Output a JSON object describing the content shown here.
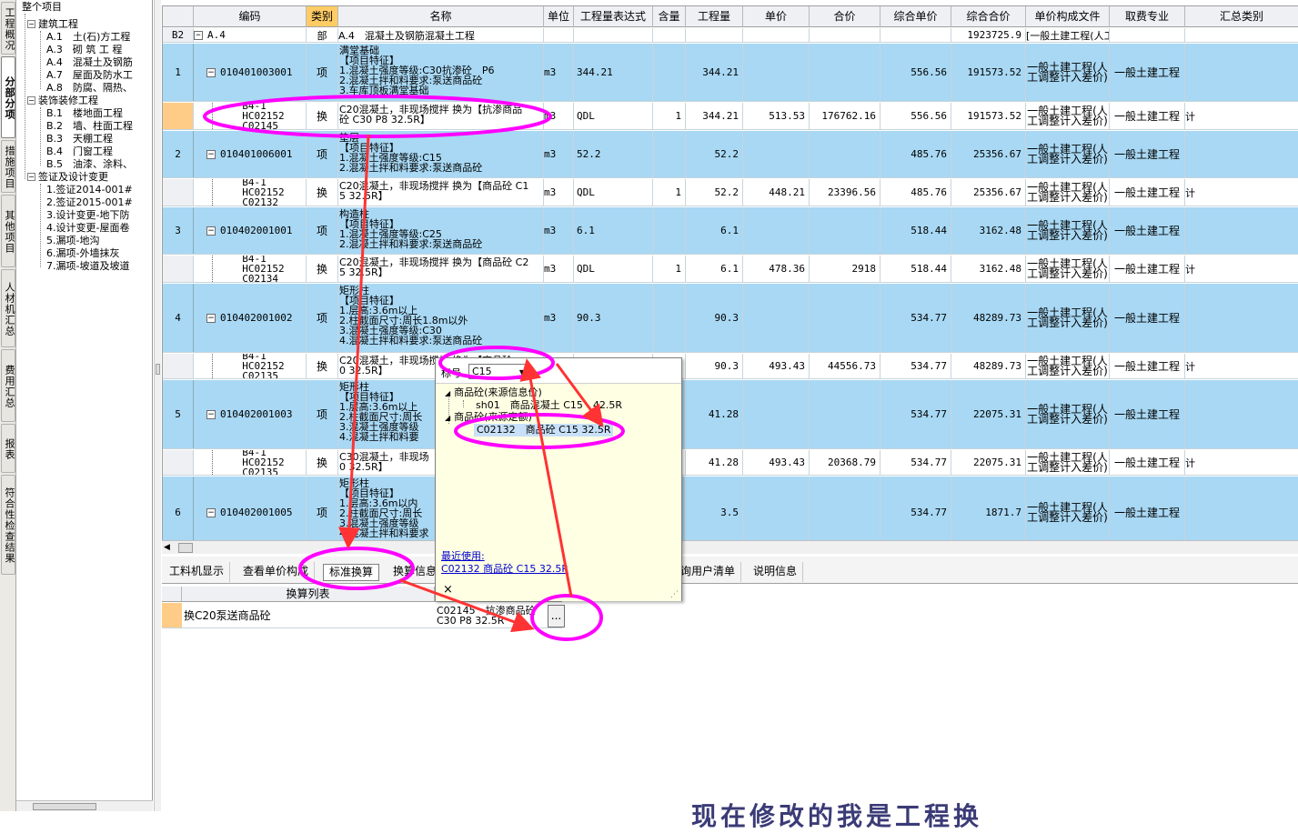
{
  "vtabs": [
    "工程概况",
    "分部分项",
    "措施项目",
    "其他项目",
    "人材机汇总",
    "费用汇总",
    "报表",
    "符合性检查结果"
  ],
  "tree": {
    "root": "整个项目",
    "groups": [
      {
        "label": "建筑工程",
        "items": [
          "A.1　土(石)方工程",
          "A.3　砌 筑 工 程",
          "A.4　混凝土及钢筋",
          "A.7　屋面及防水工",
          "A.8　防腐、隔热、"
        ]
      },
      {
        "label": "装饰装修工程",
        "items": [
          "B.1　楼地面工程",
          "B.2　墙、柱面工程",
          "B.3　天棚工程",
          "B.4　门窗工程",
          "B.5　油漆、涂料、"
        ]
      },
      {
        "label": "签证及设计变更",
        "items": [
          "1.签证2014-001#",
          "2.签证2015-001#",
          "3.设计变更-地下防",
          "4.设计变更-屋面卷",
          "5.漏项-地沟",
          "6.漏项-外墙抹灰",
          "7.漏项-坡道及坡道"
        ]
      }
    ]
  },
  "grid": {
    "headers": [
      "编码",
      "类别",
      "名称",
      "单位",
      "工程量表达式",
      "含量",
      "工程量",
      "单价",
      "合价",
      "综合单价",
      "综合合价",
      "单价构成文件",
      "取费专业",
      "汇总类别"
    ],
    "b2_row": {
      "rowhead": "B2",
      "code": "A.4",
      "type": "部",
      "name": "A.4　混凝土及钢筋混凝土工程",
      "total": "1923725.9",
      "file": "[一般土建工程(人工"
    },
    "rows": [
      {
        "kind": "item",
        "rowhead": "1",
        "code": "010401003001",
        "type": "项",
        "name": "满堂基础\n【项目特征】\n1.混凝土强度等级:C30抗渗砼　P6\n2.混凝土拌和料要求:泵送商品砼\n3.车库顶板满堂基础",
        "unit": "m3",
        "expr": "344.21",
        "content": "",
        "qty": "344.21",
        "price": "",
        "amount": "",
        "uprice": "556.56",
        "total": "191573.52",
        "file": "一般土建工程(人工调整计入差价)",
        "spec": "一般土建工程",
        "cat": ""
      },
      {
        "kind": "sub",
        "rowhead": "",
        "code": "B4-1 HC02152 C02145",
        "type": "换",
        "name": "C20混凝土，非现场搅拌 换为【抗渗商品\n砼 C30 P8 32.5R】",
        "unit": "m3",
        "expr": "QDL",
        "content": "1",
        "qty": "344.21",
        "price": "513.53",
        "amount": "176762.16",
        "uprice": "556.56",
        "total": "191573.52",
        "file": "一般土建工程(人工调整计入差价)",
        "spec": "一般土建工程",
        "cat": "计"
      },
      {
        "kind": "item",
        "rowhead": "2",
        "code": "010401006001",
        "type": "项",
        "name": "垫层\n【项目特征】\n1.混凝土强度等级:C15\n2.混凝土拌和料要求:泵送商品砼",
        "unit": "m3",
        "expr": "52.2",
        "content": "",
        "qty": "52.2",
        "price": "",
        "amount": "",
        "uprice": "485.76",
        "total": "25356.67",
        "file": "一般土建工程(人工调整计入差价)",
        "spec": "一般土建工程",
        "cat": ""
      },
      {
        "kind": "sub",
        "rowhead": "",
        "code": "B4-1 HC02152 C02132",
        "type": "换",
        "name": "C20混凝土，非现场搅拌 换为【商品砼 C1\n5 32.5R】",
        "unit": "m3",
        "expr": "QDL",
        "content": "1",
        "qty": "52.2",
        "price": "448.21",
        "amount": "23396.56",
        "uprice": "485.76",
        "total": "25356.67",
        "file": "一般土建工程(人工调整计入差价)",
        "spec": "一般土建工程",
        "cat": "计"
      },
      {
        "kind": "item",
        "rowhead": "3",
        "code": "010402001001",
        "type": "项",
        "name": "构造柱\n【项目特征】\n1.混凝土强度等级:C25\n2.混凝土拌和料要求:泵送商品砼",
        "unit": "m3",
        "expr": "6.1",
        "content": "",
        "qty": "6.1",
        "price": "",
        "amount": "",
        "uprice": "518.44",
        "total": "3162.48",
        "file": "一般土建工程(人工调整计入差价)",
        "spec": "一般土建工程",
        "cat": ""
      },
      {
        "kind": "sub",
        "rowhead": "",
        "code": "B4-1 HC02152 C02134",
        "type": "换",
        "name": "C20混凝土，非现场搅拌 换为【商品砼 C2\n5 32.5R】",
        "unit": "m3",
        "expr": "QDL",
        "content": "1",
        "qty": "6.1",
        "price": "478.36",
        "amount": "2918",
        "uprice": "518.44",
        "total": "3162.48",
        "file": "一般土建工程(人工调整计入差价)",
        "spec": "一般土建工程",
        "cat": "计"
      },
      {
        "kind": "item",
        "rowhead": "4",
        "code": "010402001002",
        "type": "项",
        "name": "矩形柱\n【项目特征】\n1.层高:3.6m以上\n2.柱截面尺寸:周长1.8m以外\n3.混凝土强度等级:C30\n4.混凝土拌和料要求:泵送商品砼",
        "unit": "m3",
        "expr": "90.3",
        "content": "",
        "qty": "90.3",
        "price": "",
        "amount": "",
        "uprice": "534.77",
        "total": "48289.73",
        "file": "一般土建工程(人工调整计入差价)",
        "spec": "一般土建工程",
        "cat": ""
      },
      {
        "kind": "sub",
        "rowhead": "",
        "code": "B4-1 HC02152 C02135",
        "type": "换",
        "name": "C20混凝土，非现场搅拌 换为【商品砼\n0 32.5R】",
        "unit": "m3",
        "expr": "QDL",
        "content": "1",
        "qty": "90.3",
        "price": "493.43",
        "amount": "44556.73",
        "uprice": "534.77",
        "total": "48289.73",
        "file": "一般土建工程(人工调整计入差价)",
        "spec": "一般土建工程",
        "cat": "计"
      },
      {
        "kind": "item",
        "rowhead": "5",
        "code": "010402001003",
        "type": "项",
        "name": "矩形柱\n【项目特征】\n1.层高:3.6m以上\n2.柱截面尺寸:周长\n3.混凝土强度等级\n4.混凝土拌和料要",
        "unit": "",
        "expr": "",
        "content": "",
        "qty": "41.28",
        "price": "",
        "amount": "",
        "uprice": "534.77",
        "total": "22075.31",
        "file": "一般土建工程(人工调整计入差价)",
        "spec": "一般土建工程",
        "cat": ""
      },
      {
        "kind": "sub",
        "rowhead": "",
        "code": "B4-1 HC02152 C02135",
        "type": "换",
        "name": "C30混凝土，非现场\n0 32.5R】",
        "unit": "",
        "expr": "",
        "content": "1",
        "qty": "41.28",
        "price": "493.43",
        "amount": "20368.79",
        "uprice": "534.77",
        "total": "22075.31",
        "file": "一般土建工程(人工调整计入差价)",
        "spec": "一般土建工程",
        "cat": "计"
      },
      {
        "kind": "item",
        "rowhead": "6",
        "code": "010402001005",
        "type": "项",
        "name": "矩形柱\n【项目特征】\n1.层高:3.6m以内\n2.柱截面尺寸:周长\n3.混凝土强度等级\n4.混凝土拌和料要求",
        "unit": "",
        "expr": "",
        "content": "",
        "qty": "3.5",
        "price": "",
        "amount": "",
        "uprice": "534.77",
        "total": "1871.7",
        "file": "一般土建工程(人工调整计入差价)",
        "spec": "一般土建工程",
        "cat": ""
      }
    ]
  },
  "bottom_tabs": [
    "工料机显示",
    "查看单价构成",
    "标准换算",
    "换算信息",
    "...",
    "询用户清单",
    "说明信息"
  ],
  "conversion": {
    "header": "换算列表",
    "row_label": "换C20泵送商品砼",
    "row_value": "C02145　抗渗商品砼\nC30 P8 32.5R",
    "button": "..."
  },
  "popup": {
    "label": "标号",
    "combo_value": "C15",
    "groups": [
      {
        "label": "商品砼(来源信息价)",
        "items": [
          "sh01　商品混凝土 C15　42.5R"
        ]
      },
      {
        "label": "商品砼(来源定额)",
        "items": [
          "C02132　商品砼 C15 32.5R"
        ]
      }
    ],
    "recent_label": "最近使用:",
    "recent_item": "C02132 商品砼 C15 32.5R",
    "close": "×"
  },
  "bottom_caption": "现在修改的我是工程换",
  "colors": {
    "row_blue": "#a8d8f4",
    "header": "#eef0f4",
    "highlight": "#ffcc66",
    "annotation": "#ff00ff",
    "arrow": "#ff3333",
    "popup_bg": "#ffffe4"
  }
}
